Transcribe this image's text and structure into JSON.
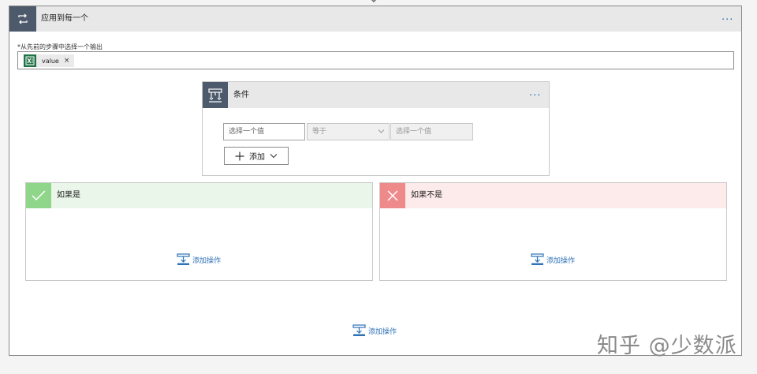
{
  "foreach": {
    "title": "应用到每一个",
    "field_label": "*从先前的步骤中选择一个输出",
    "token_value": "value",
    "token_remove": "×",
    "more_menu": "···"
  },
  "condition": {
    "title": "条件",
    "more_menu": "···",
    "left_placeholder": "选择一个值",
    "operator": "等于",
    "right_placeholder": "选择一个值",
    "add_label": "添加"
  },
  "branches": {
    "yes": {
      "title": "如果是",
      "add_action": "添加操作"
    },
    "no": {
      "title": "如果不是",
      "add_action": "添加操作"
    }
  },
  "footer": {
    "add_action": "添加操作"
  },
  "watermark": "知乎 @少数派",
  "colors": {
    "header_icon_bg": "#4d5a6b",
    "yes_icon_bg": "#8fd68a",
    "yes_header_bg": "#eaf6ea",
    "no_icon_bg": "#ee8a8a",
    "no_header_bg": "#fdeaea",
    "link": "#2f72b7",
    "excel_green": "#217346"
  }
}
